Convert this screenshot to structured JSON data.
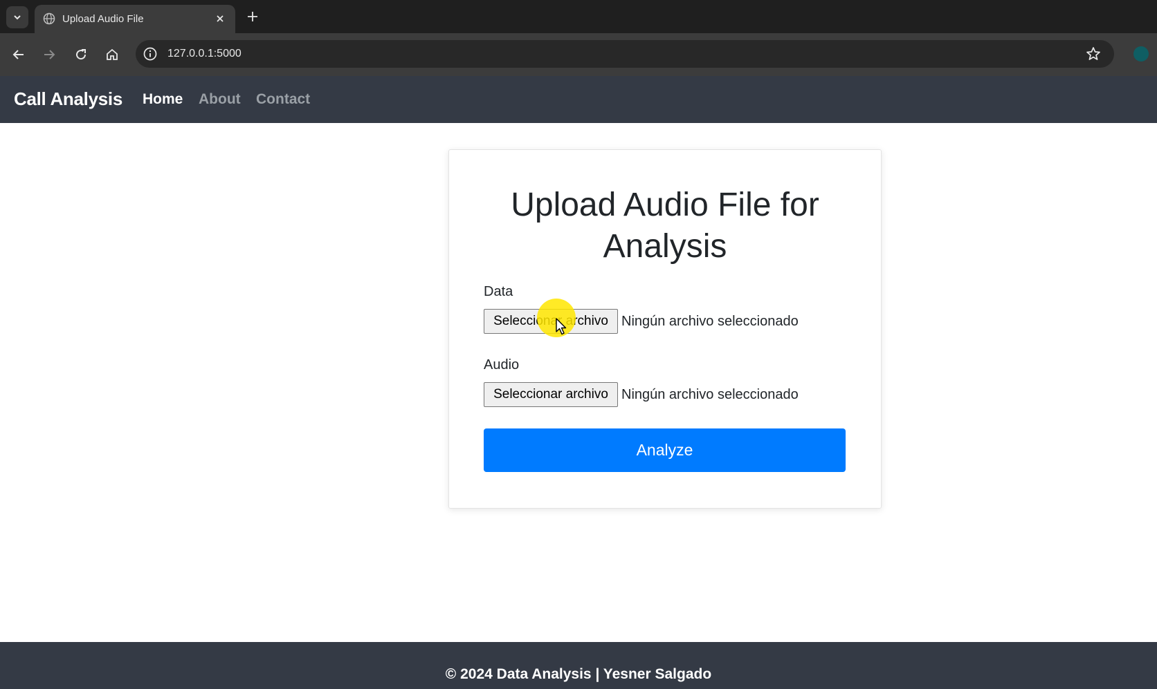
{
  "browser": {
    "tab_title": "Upload Audio File",
    "url": "127.0.0.1:5000",
    "icons": [
      "tab-list-icon",
      "globe-icon",
      "close-icon",
      "plus-icon",
      "back-icon",
      "forward-icon",
      "reload-icon",
      "home-icon",
      "info-icon",
      "star-icon",
      "extension-icon"
    ]
  },
  "navbar": {
    "brand": "Call Analysis",
    "links": [
      {
        "label": "Home",
        "active": true
      },
      {
        "label": "About",
        "active": false
      },
      {
        "label": "Contact",
        "active": false
      }
    ]
  },
  "form": {
    "title_line1": "Upload Audio File for",
    "title_line2": "Analysis",
    "fields": [
      {
        "label": "Data",
        "button_label": "Seleccionar archivo",
        "status": "Ningún archivo seleccionado"
      },
      {
        "label": "Audio",
        "button_label": "Seleccionar archivo",
        "status": "Ningún archivo seleccionado"
      }
    ],
    "submit_label": "Analyze"
  },
  "footer": {
    "text": "© 2024 Data Analysis | Yesner Salgado"
  },
  "colors": {
    "navbar_bg": "#343a45",
    "primary": "#007bff",
    "cursor_highlight": "#ffe600"
  }
}
